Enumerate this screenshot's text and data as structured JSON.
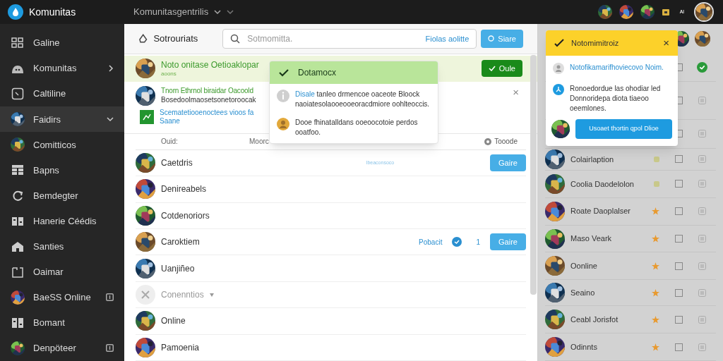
{
  "top_bar": {
    "app_name": "Komunitas",
    "breadcrumb": "Komunitasgentrilis",
    "badge_text": "ᴬᴵ"
  },
  "sidebar": {
    "items": [
      {
        "label": "Galine",
        "kind": "link",
        "selected": false
      },
      {
        "label": "Komunitas",
        "kind": "group",
        "expanded": false,
        "selected": false
      },
      {
        "label": "Caltiline",
        "kind": "link",
        "selected": false
      },
      {
        "label": "Faidirs",
        "kind": "group",
        "expanded": true,
        "selected": true
      },
      {
        "label": "Comitticos",
        "kind": "link",
        "selected": false
      },
      {
        "label": "Bapns",
        "kind": "link",
        "selected": false
      },
      {
        "label": "Bemdegter",
        "kind": "link",
        "selected": false
      },
      {
        "label": "Hanerie Céédis",
        "kind": "link",
        "selected": false
      },
      {
        "label": "Santies",
        "kind": "link",
        "selected": false
      },
      {
        "label": "Oaimar",
        "kind": "link",
        "selected": false
      },
      {
        "label": "BaeSS Online",
        "kind": "app",
        "selected": false
      },
      {
        "label": "Bomant",
        "kind": "link",
        "selected": false
      },
      {
        "label": "Denpöteer",
        "kind": "app",
        "selected": false
      }
    ]
  },
  "main": {
    "title": "Sotrouriats",
    "search": {
      "placeholder": "Sotmomitta.",
      "hint": "Fiolas aolitte"
    },
    "search_button": "Siare",
    "highlight": {
      "title": "Noto onitase Oetioaklopar",
      "sub": "aoons",
      "button": "Oule"
    },
    "notice": {
      "title": "Tnorn Ethrnol biraidar Oacoold",
      "body": "Bosedoolmaosetsonetoroocak",
      "link": "Scematetiooenoctees vioos fa",
      "link_sub": "Saane",
      "close": "×"
    },
    "columns": [
      "Ouid:",
      "Moorc",
      "Tooode"
    ],
    "rows": [
      {
        "name": "Caetdris",
        "note": "Ibeaconsoco",
        "button": "Gaire"
      },
      {
        "name": "Denireabels"
      },
      {
        "name": "Cotdenoriors"
      },
      {
        "name": "Caroktiem",
        "status": "Pobacit",
        "count": "1",
        "verified": true,
        "button": "Gaire"
      },
      {
        "name": "Uanjiñeo"
      },
      {
        "name": "Conenntios",
        "muted": true
      },
      {
        "name": "Online"
      },
      {
        "name": "Pamoenia"
      }
    ]
  },
  "dropdown": {
    "header": "Dotamocx",
    "items": [
      {
        "kind": "info",
        "lead": "Disale",
        "text": "tanleo drmencoe oaceote Bloock naoiatesolaooeooeoracdmiore oohlteoccis."
      },
      {
        "kind": "person",
        "text": "Dooe fhinatalldans ooeoocotoie perdos ooatfoo."
      }
    ]
  },
  "right_panel": {
    "rows": [
      {
        "checked": false,
        "done": true
      },
      {
        "checked": false,
        "done": false
      },
      {
        "checked": false,
        "done": false
      },
      {
        "name": "Colairlaption",
        "starred": false,
        "checked": false,
        "done": false
      },
      {
        "name": "Coolia Daodelolon",
        "starred": false,
        "checked": false,
        "done": false
      },
      {
        "name": "Roate Daoplalser",
        "starred": true,
        "checked": false,
        "done": false
      },
      {
        "name": "Maso Veark",
        "starred": true,
        "checked": false,
        "done": false
      },
      {
        "name": "Oonline",
        "starred": true,
        "checked": false,
        "done": false
      },
      {
        "name": "Seaino",
        "starred": true,
        "checked": false,
        "done": false
      },
      {
        "name": "Ceabl Jorisfot",
        "starred": true,
        "checked": false,
        "done": false
      },
      {
        "name": "Odinnts",
        "starred": true,
        "checked": false,
        "done": false
      }
    ]
  },
  "notification": {
    "title": "Notomimitroiz",
    "close": "×",
    "items": [
      {
        "kind": "person",
        "text": "Notofikamarifhoviecovo Noim."
      },
      {
        "kind": "share",
        "text": "Ronoedordue las ohodiar led Donnoridepa diota tiaeoo oeemlones."
      }
    ],
    "button": "Usoaet thortin qpol Dlioe"
  }
}
